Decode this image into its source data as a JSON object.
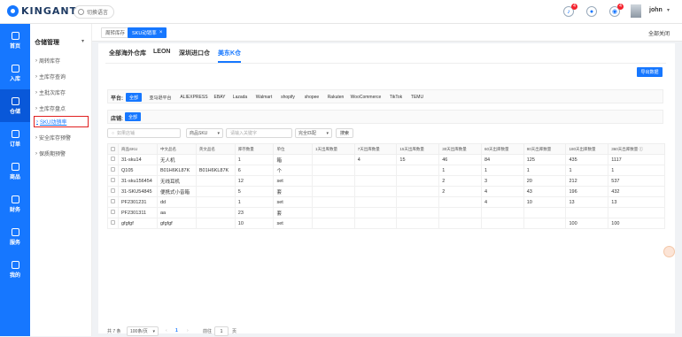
{
  "app": {
    "logo_text": "KINGANT",
    "language_label": "切换语言"
  },
  "header": {
    "badges": [
      "4",
      "4"
    ],
    "user": "john",
    "caret": "▾"
  },
  "sidebar": {
    "items": [
      {
        "icon": "home-icon",
        "label": "首页"
      },
      {
        "icon": "inbound-icon",
        "label": "入库"
      },
      {
        "icon": "warehouse-icon",
        "label": "仓储"
      },
      {
        "icon": "order-icon",
        "label": "订单"
      },
      {
        "icon": "product-icon",
        "label": "商品"
      },
      {
        "icon": "finance-icon",
        "label": "财务"
      },
      {
        "icon": "service-icon",
        "label": "服务"
      },
      {
        "icon": "profile-icon",
        "label": "我的"
      }
    ]
  },
  "submenu": {
    "title": "仓储管理",
    "caret": "▾",
    "items": [
      "周转库存",
      "主库存查询",
      "主批次库存",
      "主库存盘点",
      "SKU动销率",
      "安全库存预警",
      "保质期预警"
    ],
    "active_index": 4
  },
  "page_tabs": [
    {
      "label": "周转库存"
    },
    {
      "label": "SKU动销率"
    }
  ],
  "close_all": "全部关闭",
  "warehouse_tabs": [
    "全部海外仓库",
    "LEON",
    "深圳进口仓",
    "美东K仓"
  ],
  "warehouse_active": 3,
  "export_label": "导出数据",
  "filters": {
    "platform_label": "平台:",
    "platforms": [
      "全部",
      "亚马逊平台",
      "ALIEXPRESS",
      "EBAY",
      "Lazada",
      "Walmart",
      "shopify",
      "shopee",
      "Rakuten",
      "WooCommerce",
      "TikTok",
      "TEMU"
    ],
    "shop_label": "店铺:",
    "shop_options": [
      "全部"
    ],
    "search_placeholder": "如果店铺",
    "field_select": "商品SKU",
    "keyword_placeholder": "请输入关键字",
    "match_select": "完全匹配",
    "search_button": "搜索"
  },
  "table": {
    "headers": [
      "商品SKU",
      "中文品名",
      "英文品名",
      "库存数量",
      "单位",
      "1天出库数量",
      "7天出库数量",
      "15天出库数量",
      "30天出库数量",
      "60天出库数量",
      "90天出库数量",
      "180天出库数量",
      "360天出库数量 ⓘ"
    ],
    "rows": [
      [
        "31-sku14",
        "无人机",
        "",
        "1",
        "箱",
        "",
        "4",
        "15",
        "46",
        "84",
        "125",
        "435",
        "1117"
      ],
      [
        "Q105",
        "B01H6KL87K",
        "B01H6KL87K",
        "6",
        "个",
        "",
        "",
        "",
        "1",
        "1",
        "1",
        "1",
        "1"
      ],
      [
        "31-sku156454",
        "无线耳机",
        "",
        "12",
        "set",
        "",
        "",
        "",
        "2",
        "3",
        "20",
        "212",
        "537"
      ],
      [
        "31-SKU54845",
        "便携式小音箱",
        "",
        "5",
        "套",
        "",
        "",
        "",
        "2",
        "4",
        "43",
        "196",
        "432"
      ],
      [
        "PF2301231",
        "dd",
        "",
        "1",
        "set",
        "",
        "",
        "",
        "",
        "4",
        "10",
        "13",
        "13"
      ],
      [
        "PF2301311",
        "aa",
        "",
        "23",
        "套",
        "",
        "",
        "",
        "",
        "",
        "",
        "",
        ""
      ],
      [
        "gfgfgf",
        "gfgfgf",
        "",
        "10",
        "set",
        "",
        "",
        "",
        "",
        "",
        "",
        "100",
        "100"
      ]
    ]
  },
  "pager": {
    "total": "共 7 条",
    "page_size": "100条/页",
    "prev": "‹",
    "current": "1",
    "next": "›",
    "goto_label": "前往",
    "goto_value": "1",
    "page_unit": "页"
  },
  "colors": {
    "primary": "#1677ff",
    "sidebar_active": "#0958d9",
    "highlight_box": "#e02020"
  }
}
